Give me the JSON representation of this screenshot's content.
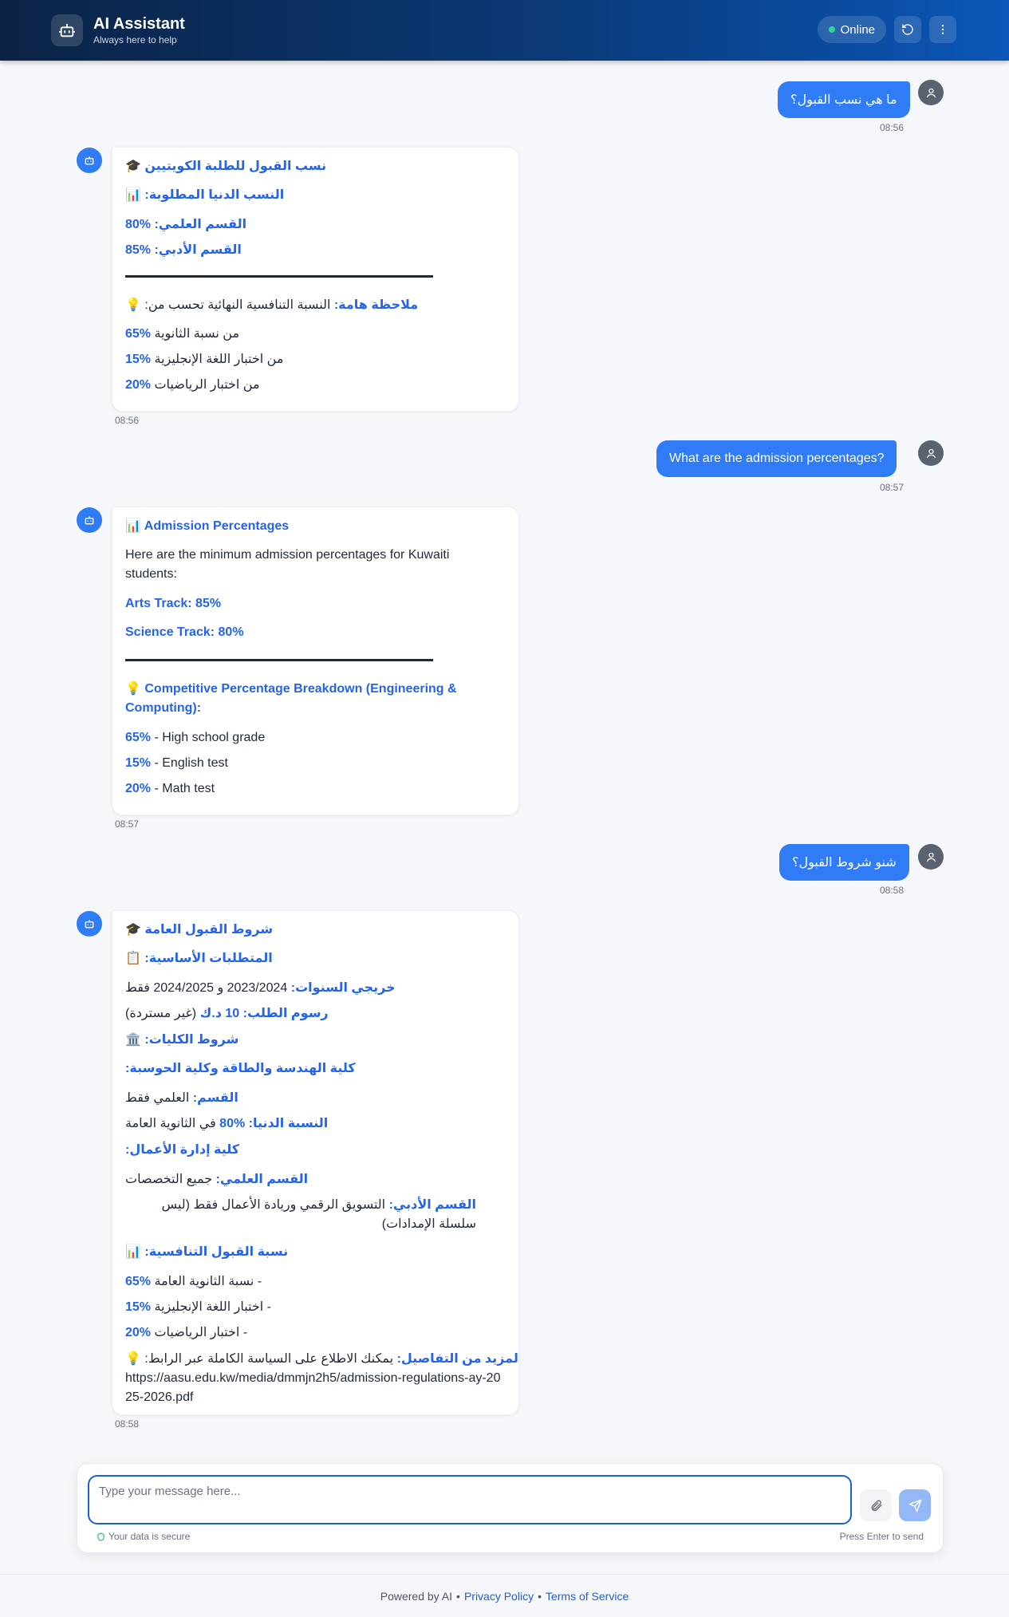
{
  "header": {
    "title": "AI Assistant",
    "subtitle": "Always here to help",
    "status": "Online",
    "icons": [
      "robot-icon",
      "refresh-icon",
      "more-vertical-icon"
    ]
  },
  "messages": {
    "m1": {
      "text": "ما هي نسب القبول؟",
      "time": "08:56"
    },
    "b1": {
      "title": "نسب القبول للطلبة الكويتيين",
      "title_emoji": "🎓",
      "min_heading_emoji": "📊",
      "min_heading": "النسب الدنيا المطلوبة:",
      "sci_label": "القسم العلمي:",
      "sci_value": "80%",
      "arts_label": "القسم الأدبي:",
      "arts_value": "85%",
      "note_emoji": "💡",
      "note_label": "ملاحظة هامة:",
      "note_text": "النسبة التنافسية النهائية تحسب من:",
      "r1_val": "65%",
      "r1_text": "من نسبة الثانوية",
      "r2_val": "15%",
      "r2_text": "من اختبار اللغة الإنجليزية",
      "r3_val": "20%",
      "r3_text": "من اختبار الرياضيات",
      "time": "08:56"
    },
    "m2": {
      "text": "What are the admission percentages?",
      "time": "08:57"
    },
    "b2": {
      "title_emoji": "📊",
      "title": "Admission Percentages",
      "intro": "Here are the minimum admission percentages for Kuwaiti students:",
      "arts": "Arts Track: 85%",
      "science": "Science Track: 80%",
      "breakdown_emoji": "💡",
      "breakdown": "Competitive Percentage Breakdown (Engineering & Computing):",
      "r1_val": "65%",
      "r1_text": " - High school grade",
      "r2_val": "15%",
      "r2_text": " - English test",
      "r3_val": "20%",
      "r3_text": " - Math test",
      "time": "08:57"
    },
    "m3": {
      "text": "شنو شروط القبول؟",
      "time": "08:58"
    },
    "b3": {
      "title_emoji": "🎓",
      "title": "شروط القبول العامة",
      "req_emoji": "📋",
      "req_heading": "المتطلبات الأساسية:",
      "grad_label": "خريجي السنوات:",
      "grad_text": "2023/2024 و 2024/2025 فقط",
      "fee_label": "رسوم الطلب:",
      "fee_value": "10 د.ك",
      "fee_text": "(غير مستردة)",
      "col_emoji": "🏛️",
      "col_heading": "شروط الكليات:",
      "eng_heading": "كلية الهندسة والطاقة وكلية الحوسبة:",
      "dept_label": "القسم:",
      "dept_text": "العلمي فقط",
      "min_label": "النسبة الدنيا:",
      "min_value": "80%",
      "min_text": "في الثانوية العامة",
      "biz_heading": "كلية إدارة الأعمال:",
      "biz_sci_label": "القسم العلمي:",
      "biz_sci_text": "جميع التخصصات",
      "biz_arts_label": "القسم الأدبي:",
      "biz_arts_text": "التسويق الرقمي وريادة الأعمال فقط (ليس سلسلة الإمدادات)",
      "comp_emoji": "📊",
      "comp_heading": "نسبة القبول التنافسية:",
      "c1_val": "65%",
      "c1_text": "- نسبة الثانوية العامة",
      "c2_val": "15%",
      "c2_text": "- اختبار اللغة الإنجليزية",
      "c3_val": "20%",
      "c3_text": "- اختبار الرياضيات",
      "more_emoji": "💡",
      "more_label": "لمزيد من التفاصيل:",
      "more_text": "يمكنك الاطلاع على السياسة الكاملة عبر الرابط:",
      "link": "https://aasu.edu.kw/media/dmmjn2h5/admission-regulations-ay-2025-2026.pdf",
      "time": "08:58"
    }
  },
  "composer": {
    "placeholder": "Type your message here...",
    "secure": "Your data is secure",
    "hint": "Press Enter to send"
  },
  "footer": {
    "powered": "Powered by AI",
    "bullet": "•",
    "privacy": "Privacy Policy",
    "terms": "Terms of Service"
  },
  "colors": {
    "accent": "#2f7cf6",
    "heading": "#2563eb",
    "online": "#34d399"
  }
}
